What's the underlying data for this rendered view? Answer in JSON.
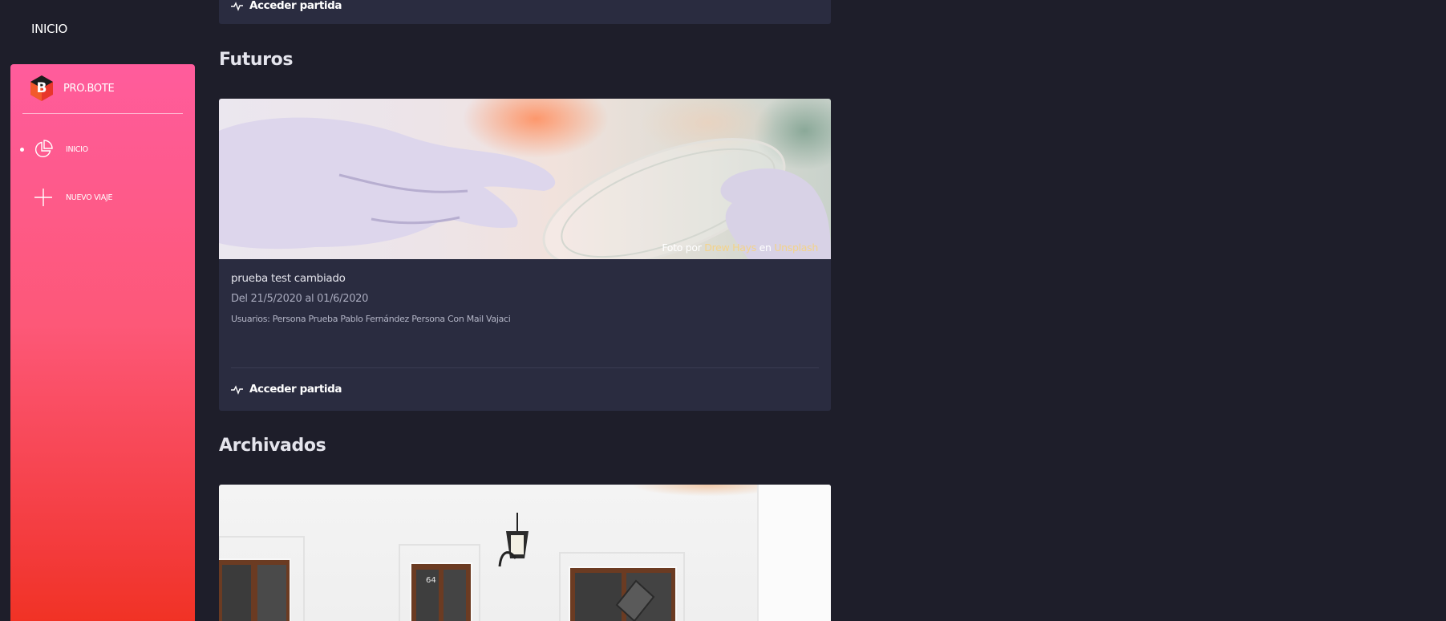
{
  "header": {
    "title": "INICIO"
  },
  "sidebar": {
    "brand": {
      "logo_letter": "B",
      "name": "PRO.BOTE"
    },
    "items": [
      {
        "label": "INICIO",
        "icon": "pie-chart-icon",
        "active": true
      },
      {
        "label": "NUEVO VIAJE",
        "icon": "plus-icon",
        "active": false
      }
    ]
  },
  "main": {
    "top_card": {
      "action_label": "Acceder partida"
    },
    "sections": [
      {
        "title": "Futuros",
        "card": {
          "image": "gloved-hands-petri-dish",
          "credit": {
            "prefix": "Foto por",
            "author": "Drew Hays",
            "middle": "en",
            "site": "Unsplash"
          },
          "name": "prueba test cambiado",
          "dates": "Del 21/5/2020 al 01/6/2020",
          "users": "Usuarios: Persona Prueba Pablo Fernández Persona Con Mail Vajaci",
          "action_label": "Acceder partida"
        }
      },
      {
        "title": "Archivados",
        "card": {
          "image": "white-house-facade-windows-lamp"
        }
      }
    ]
  },
  "colors": {
    "background": "#1e1e2a",
    "card": "#2a2c40",
    "sidebar_gradient_top": "#ff5c9c",
    "sidebar_gradient_bottom": "#f0301e",
    "credit_highlight": "#f3d38a"
  }
}
